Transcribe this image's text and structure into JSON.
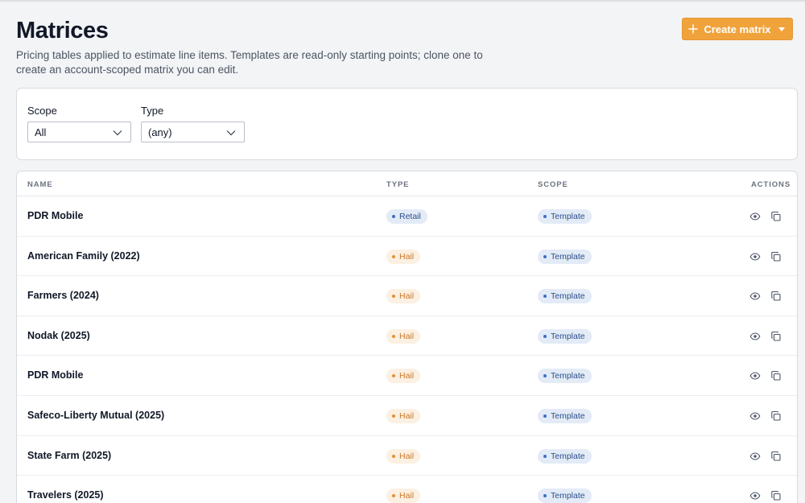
{
  "header": {
    "title": "Matrices",
    "subtitle": "Pricing tables applied to estimate line items. Templates are read-only starting points; clone one to create an account-scoped matrix you can edit."
  },
  "actions": {
    "create_label": "Create matrix",
    "create_color": "#f0a33b"
  },
  "filters": {
    "scope": {
      "label": "Scope",
      "value": "All"
    },
    "type": {
      "label": "Type",
      "value": "(any)"
    }
  },
  "table": {
    "columns": {
      "name": "NAME",
      "type": "TYPE",
      "scope": "SCOPE",
      "actions": "ACTIONS"
    },
    "rows": [
      {
        "name": "PDR Mobile",
        "type": "Retail",
        "scope": "Template"
      },
      {
        "name": "American Family (2022)",
        "type": "Hail",
        "scope": "Template"
      },
      {
        "name": "Farmers (2024)",
        "type": "Hail",
        "scope": "Template"
      },
      {
        "name": "Nodak (2025)",
        "type": "Hail",
        "scope": "Template"
      },
      {
        "name": "PDR Mobile",
        "type": "Hail",
        "scope": "Template"
      },
      {
        "name": "Safeco-Liberty Mutual (2025)",
        "type": "Hail",
        "scope": "Template"
      },
      {
        "name": "State Farm (2025)",
        "type": "Hail",
        "scope": "Template"
      },
      {
        "name": "Travelers (2025)",
        "type": "Hail",
        "scope": "Template"
      }
    ],
    "row_action_icons": [
      "eye-icon",
      "copy-icon"
    ]
  },
  "colors": {
    "retail_badge": "#e3ebf7",
    "hail_badge": "#fbf0e2",
    "scope_badge": "#e3ebf7"
  }
}
